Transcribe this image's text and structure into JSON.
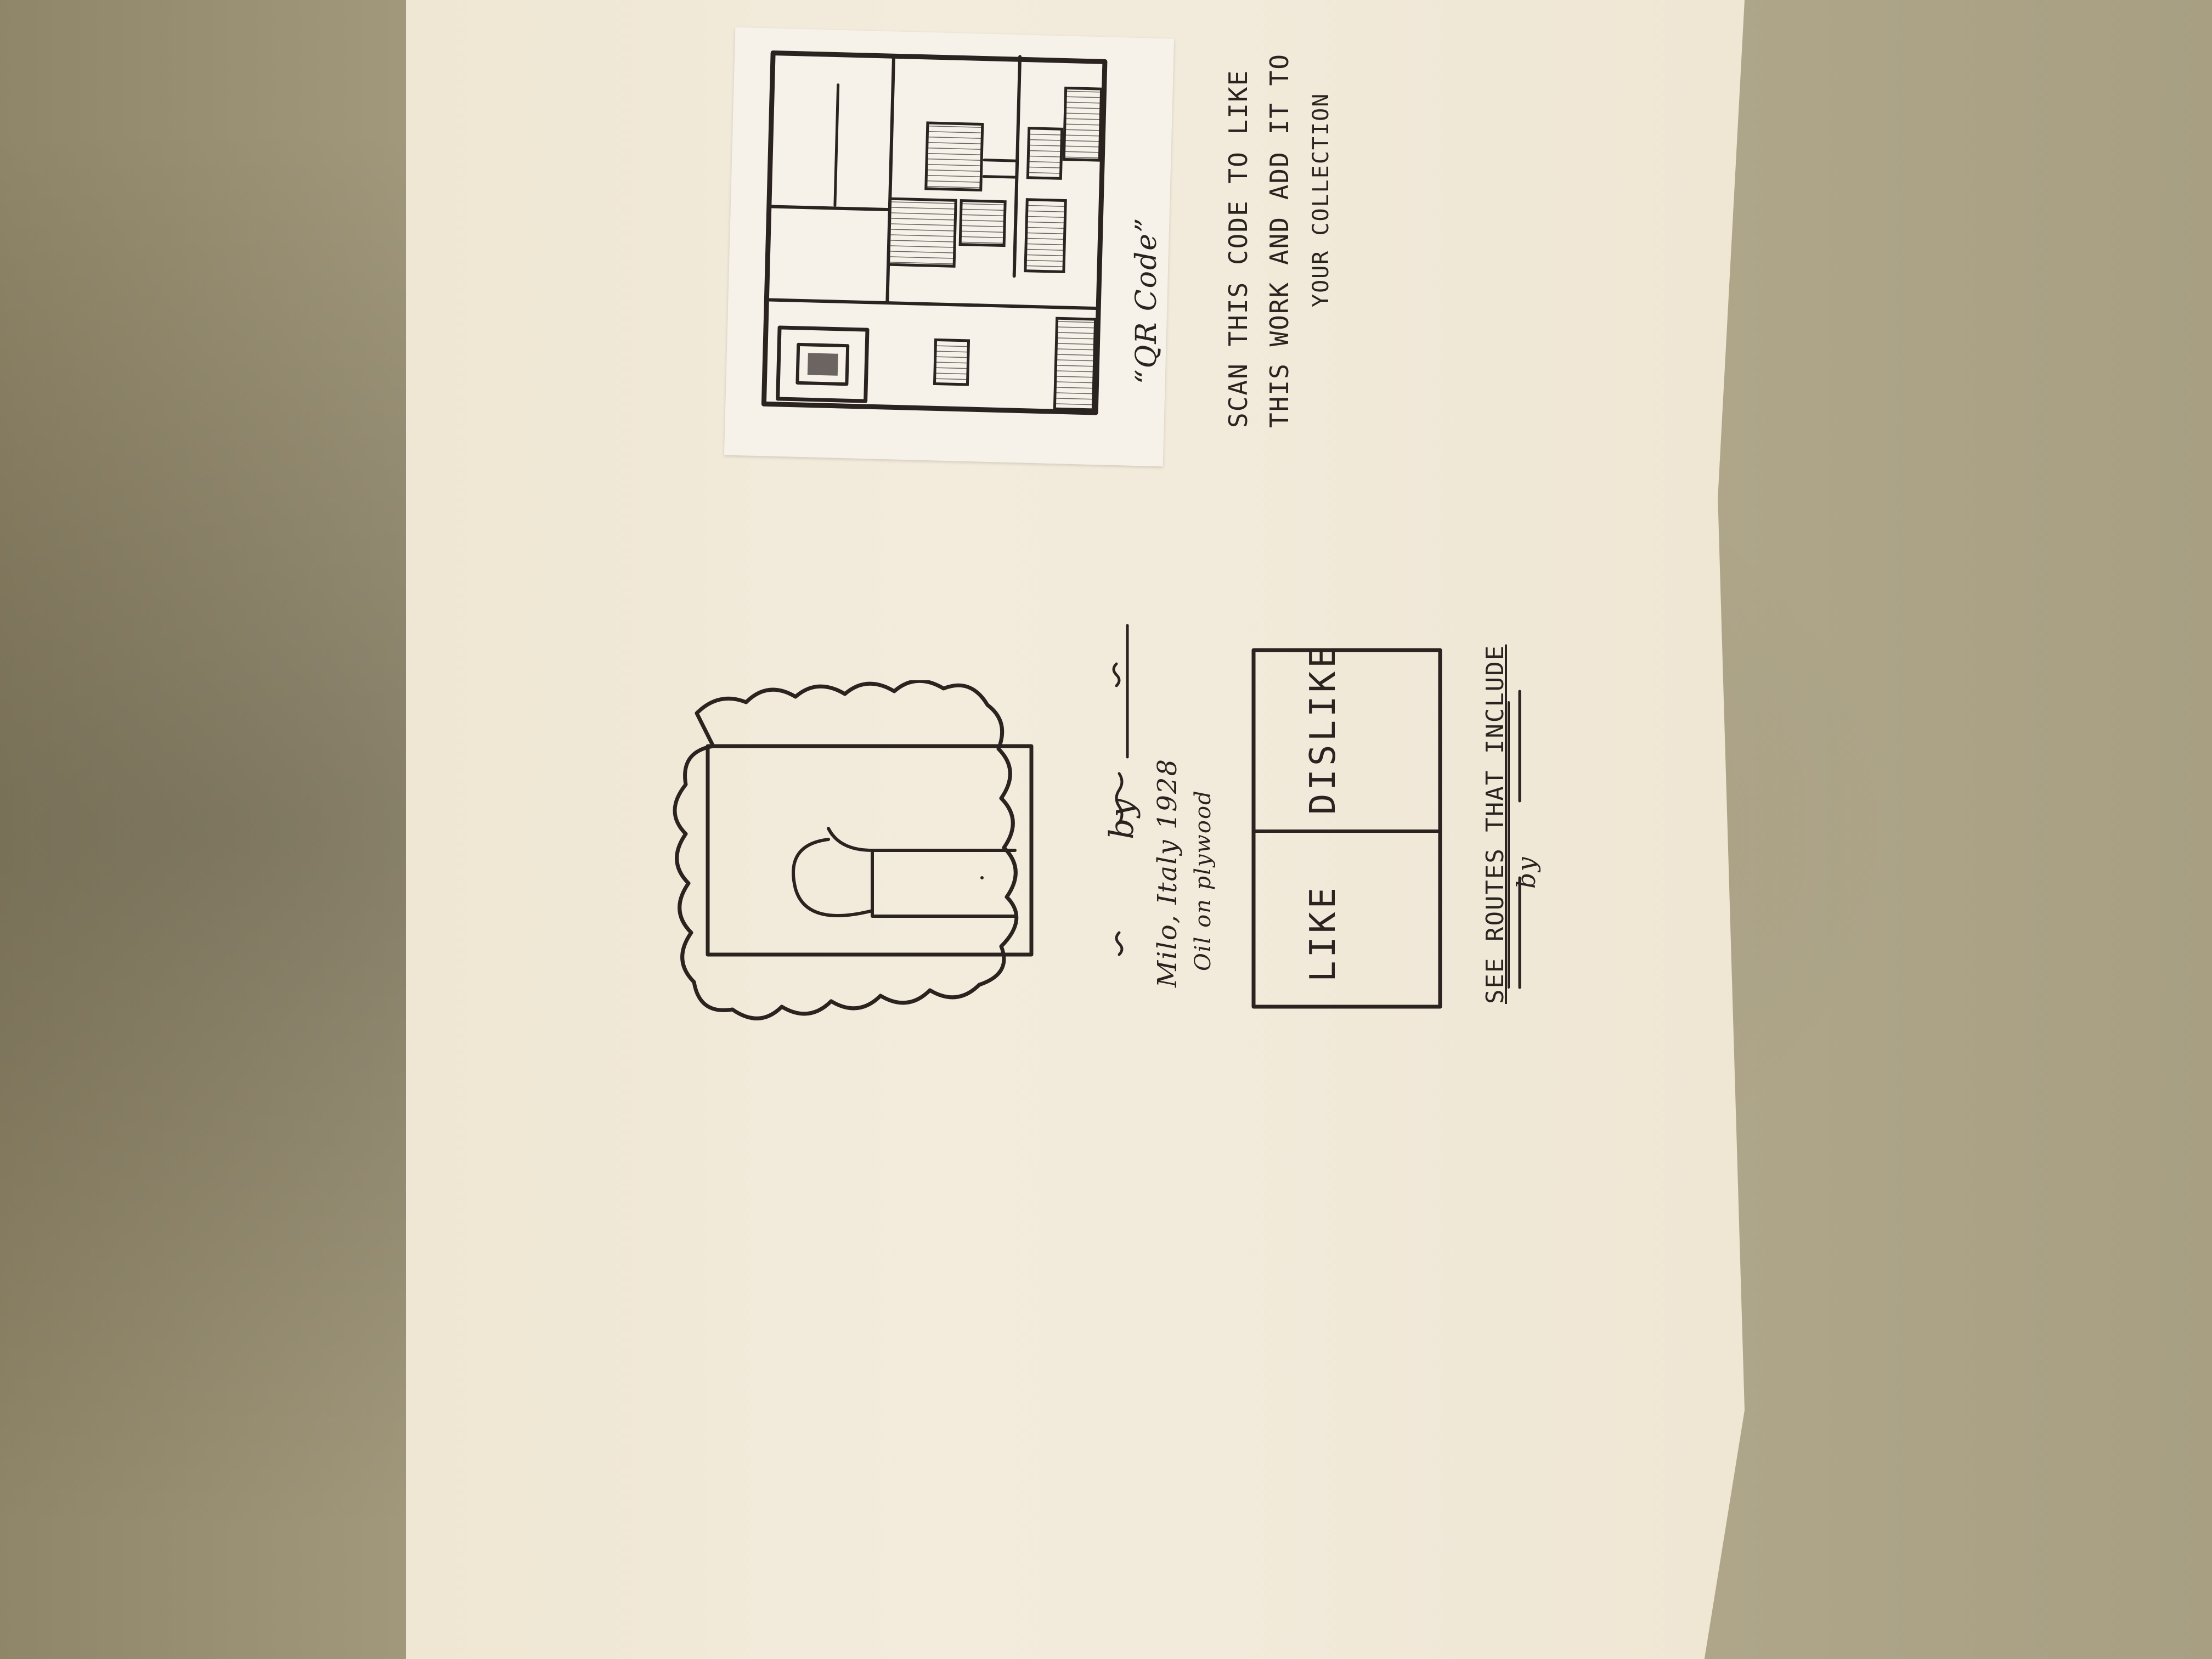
{
  "qr": {
    "label": "“QR Code”",
    "caption_line1": "SCAN THIS CODE TO LIKE",
    "caption_line2": "THIS WORK AND ADD IT TO",
    "caption_line3": "YOUR COLLECTION"
  },
  "artwork": {
    "byline": "by",
    "location_year": "Milo, Italy 1928",
    "medium": "Oil on plywood"
  },
  "actions": {
    "like_label": "LIKE",
    "dislike_label": "DISLIKE"
  },
  "routes": {
    "heading": "SEE ROUTES THAT INCLUDE",
    "byline": "by"
  }
}
